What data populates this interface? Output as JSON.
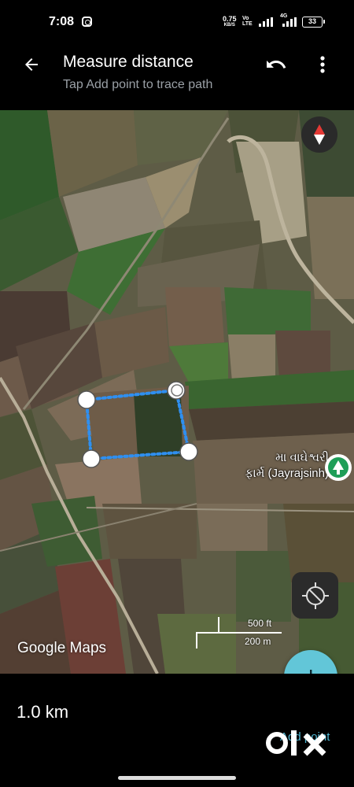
{
  "status_bar": {
    "time": "7:08",
    "net_speed_value": "0.75",
    "net_speed_unit": "KB/S",
    "volte_top": "Vo",
    "volte_bottom": "LTE",
    "network_2": "4G",
    "battery": "33"
  },
  "app_bar": {
    "title": "Measure distance",
    "subtitle": "Tap Add point to trace path",
    "icons": [
      "back-arrow-icon",
      "undo-icon",
      "more-vert-icon"
    ]
  },
  "map": {
    "place_name_line1": "મા વાઘેશ્વરી",
    "place_name_line2": "ફાર્મ (Jayrajsinh)",
    "scale_feet": "500 ft",
    "scale_meters": "200 m",
    "attribution": "Google Maps",
    "measure_line_color": "#2f8ff0",
    "fab_color": "#62c6d8"
  },
  "bottom": {
    "distance": "1.0 km",
    "add_point_label": "Add point"
  }
}
